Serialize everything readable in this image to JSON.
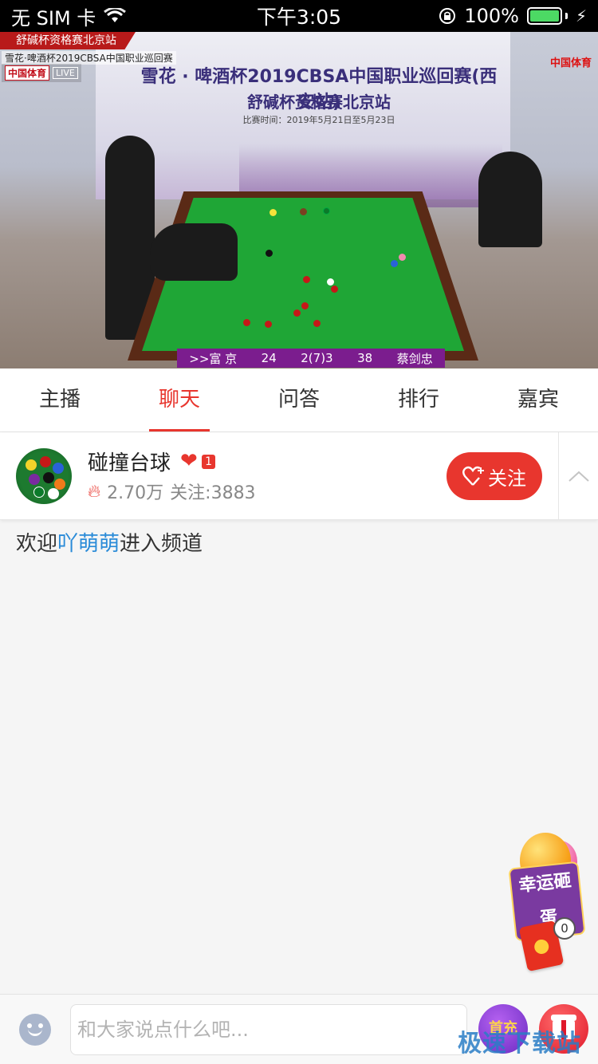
{
  "status_bar": {
    "carrier": "无 SIM 卡",
    "time": "下午3:05",
    "battery": "100%",
    "battery_level": 1.0
  },
  "video": {
    "station_banner": "舒碱杯资格赛北京站",
    "event_small": "雪花·啤酒杯2019CBSA中国职业巡回赛",
    "broadcaster": "中国体育",
    "live_tag": "LIVE",
    "backdrop_title": "雪花 · 啤酒杯2019CBSA中国职业巡回赛(西安站)",
    "backdrop_subtitle": "舒碱杯资格赛北京站",
    "backdrop_date": "比赛时间：2019年5月21日至5月23日",
    "corner_logo": "中国体育",
    "scoreboard": {
      "player1": ">>富 京",
      "score1": "24",
      "frames": "2(7)3",
      "score2": "38",
      "player2": "蔡剑忠"
    }
  },
  "tabs": [
    {
      "label": "主播",
      "active": false
    },
    {
      "label": "聊天",
      "active": true
    },
    {
      "label": "问答",
      "active": false
    },
    {
      "label": "排行",
      "active": false
    },
    {
      "label": "嘉宾",
      "active": false
    }
  ],
  "anchor": {
    "name": "碰撞台球",
    "level": "1",
    "popularity": "2.70万",
    "followers": "关注:3883",
    "follow_label": "关注"
  },
  "chat": {
    "welcome_prefix": "欢迎",
    "welcome_user": "吖萌萌",
    "welcome_suffix": "进入频道"
  },
  "floating": {
    "lucky_egg_label": "幸运砸蛋",
    "redpacket_count": "0"
  },
  "bottom_bar": {
    "input_placeholder": "和大家说点什么吧...",
    "first_charge_label": "首充"
  },
  "watermark": "极速下载站",
  "colors": {
    "accent": "#e8362e",
    "link": "#2a8bd8",
    "scoreboard": "#7b1d8e"
  }
}
